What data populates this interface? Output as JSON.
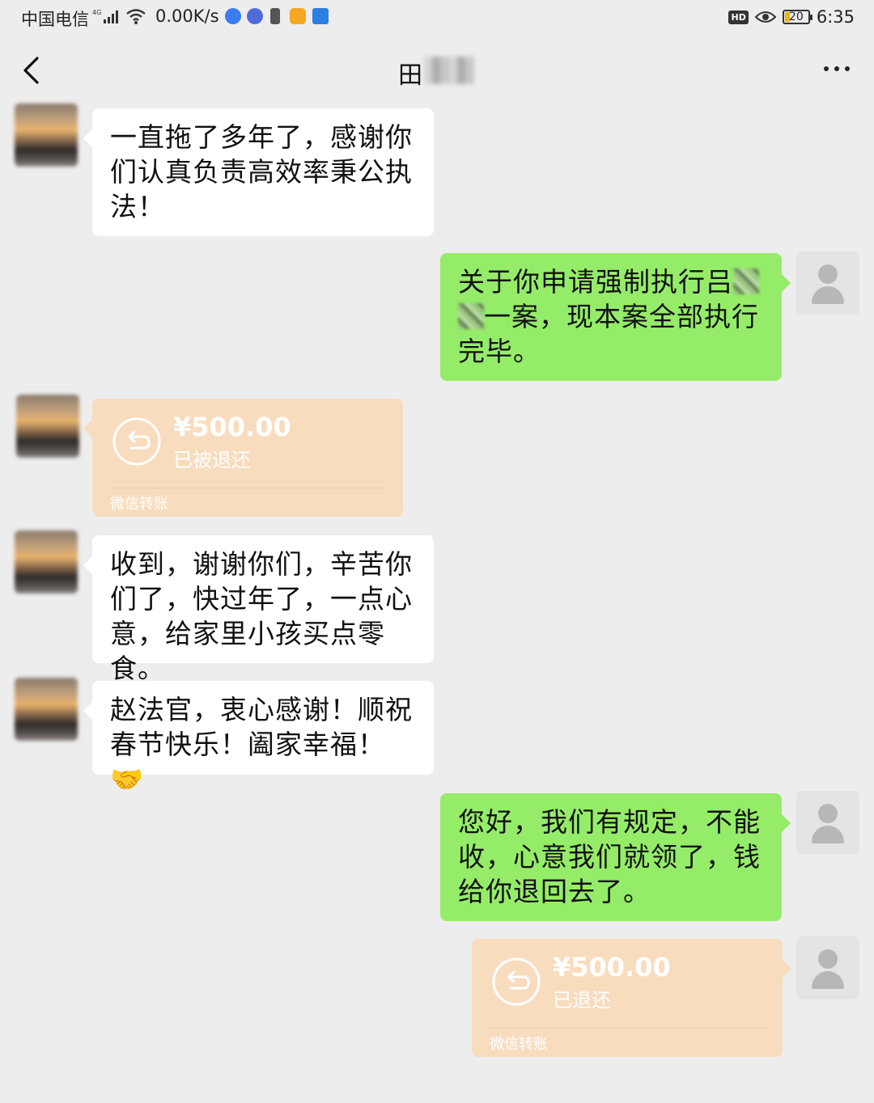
{
  "status_bar": {
    "carrier": "中国电信",
    "net_speed": "0.00K/s",
    "hd_label": "HD",
    "battery": "20",
    "time": "6:35"
  },
  "nav": {
    "title": "田"
  },
  "messages": [
    {
      "text": "一直拖了多年了，感谢你们认真负责高效率秉公执法！"
    },
    {
      "text_a": "关于你申请强制执行吕",
      "text_b": "一案，现本案全部执行完毕。"
    },
    {
      "amount": "¥500.00",
      "status": "已被退还",
      "footer": "微信转账"
    },
    {
      "text": "收到，谢谢你们，辛苦你们了，快过年了，一点心意，给家里小孩买点零食。"
    },
    {
      "text": "赵法官，衷心感谢！顺祝春节快乐！阖家幸福！🤝"
    },
    {
      "text": "您好，我们有规定，不能收，心意我们就领了，钱给你退回去了。"
    },
    {
      "amount": "¥500.00",
      "status": "已退还",
      "footer": "微信转账"
    }
  ],
  "colors": {
    "background": "#ededed",
    "bubble_out": "#95ec69",
    "bubble_in": "#ffffff",
    "transfer": "#f8dcbe"
  }
}
